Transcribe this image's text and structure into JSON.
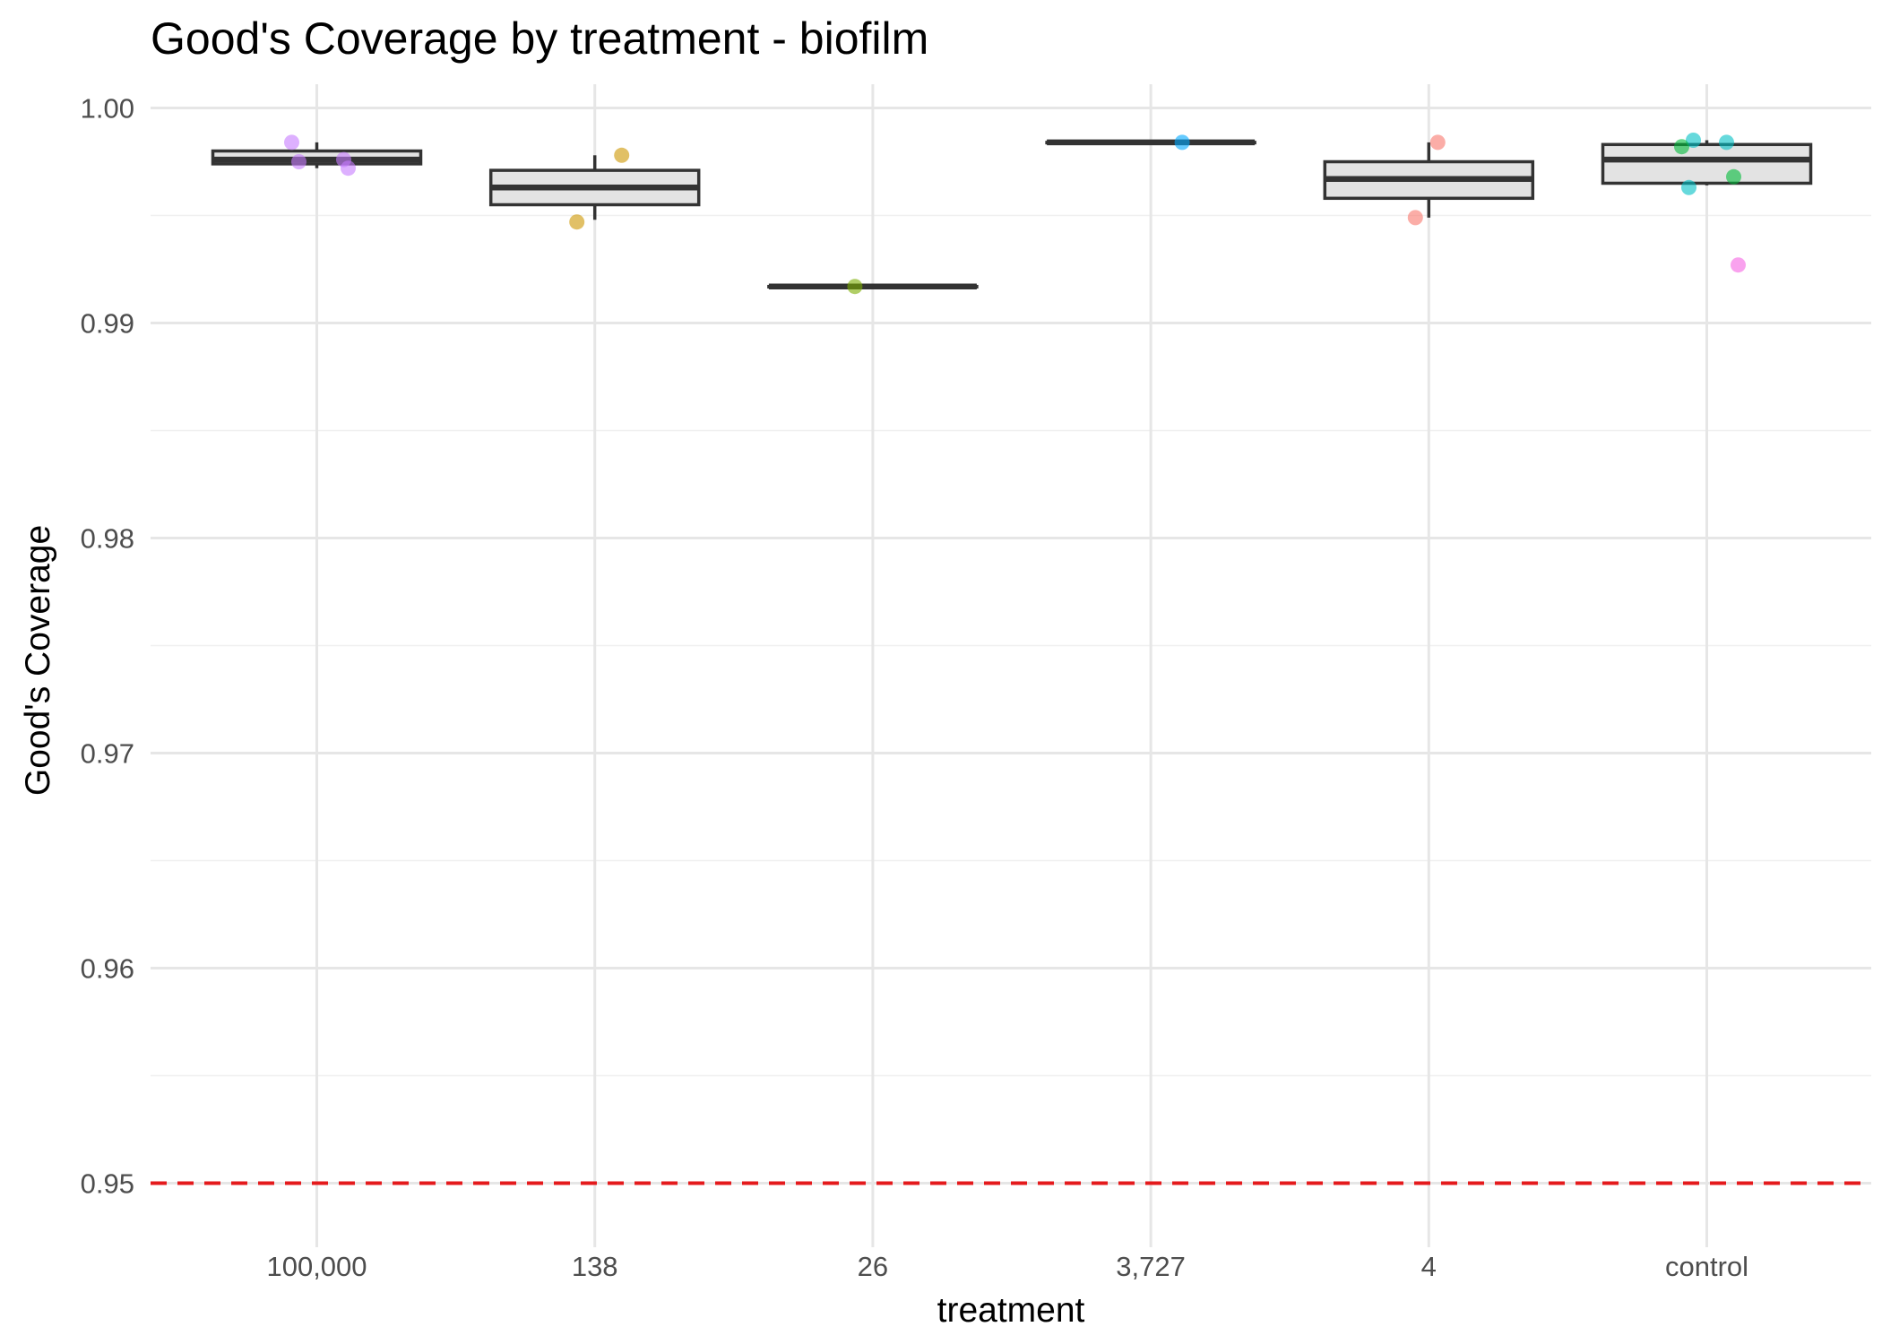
{
  "chart_data": {
    "type": "box",
    "title": "Good's Coverage by treatment - biofilm",
    "xlabel": "treatment",
    "ylabel": "Good's Coverage",
    "ylim": [
      0.948,
      1.001
    ],
    "yticks": [
      0.95,
      0.96,
      0.97,
      0.98,
      0.99,
      1.0
    ],
    "ytick_labels": [
      "0.95",
      "0.96",
      "0.97",
      "0.98",
      "0.99",
      "1.00"
    ],
    "categories": [
      "100,000",
      "138",
      "26",
      "3,727",
      "4",
      "control"
    ],
    "reference_line": {
      "y": 0.95,
      "color": "#e41a1c",
      "style": "dashed"
    },
    "grid": true,
    "legend": "none",
    "boxes": [
      {
        "category": "100,000",
        "color": "#c77cff",
        "min": 0.9972,
        "q1": 0.9974,
        "median": 0.9976,
        "q3": 0.998,
        "max": 0.9984,
        "points": [
          0.9984,
          0.9976,
          0.9975,
          0.9972
        ]
      },
      {
        "category": "138",
        "color": "#cd9600",
        "min": 0.9948,
        "q1": 0.9955,
        "median": 0.9963,
        "q3": 0.9971,
        "max": 0.9978,
        "points": [
          0.9978,
          0.9947
        ]
      },
      {
        "category": "26",
        "color": "#7cae00",
        "min": 0.9917,
        "q1": 0.9917,
        "median": 0.9917,
        "q3": 0.9917,
        "max": 0.9917,
        "points": [
          0.9917
        ]
      },
      {
        "category": "3,727",
        "color": "#00a9ff",
        "min": 0.9984,
        "q1": 0.9984,
        "median": 0.9984,
        "q3": 0.9984,
        "max": 0.9984,
        "points": [
          0.9984
        ]
      },
      {
        "category": "4",
        "color": "#f8766d",
        "min": 0.9949,
        "q1": 0.9958,
        "median": 0.9967,
        "q3": 0.9975,
        "max": 0.9984,
        "points": [
          0.9984,
          0.9949
        ]
      },
      {
        "category": "control",
        "color": "#00c19a",
        "min": 0.9964,
        "q1": 0.9965,
        "median": 0.9976,
        "q3": 0.9983,
        "max": 0.9985,
        "points": [
          {
            "y": 0.9985,
            "color": "#00bfc4"
          },
          {
            "y": 0.9984,
            "color": "#00bfc4"
          },
          {
            "y": 0.9982,
            "color": "#00ba38"
          },
          {
            "y": 0.9968,
            "color": "#00ba38"
          },
          {
            "y": 0.9963,
            "color": "#00bfc4"
          },
          {
            "y": 0.9927,
            "color": "#f564e3"
          }
        ]
      }
    ]
  }
}
